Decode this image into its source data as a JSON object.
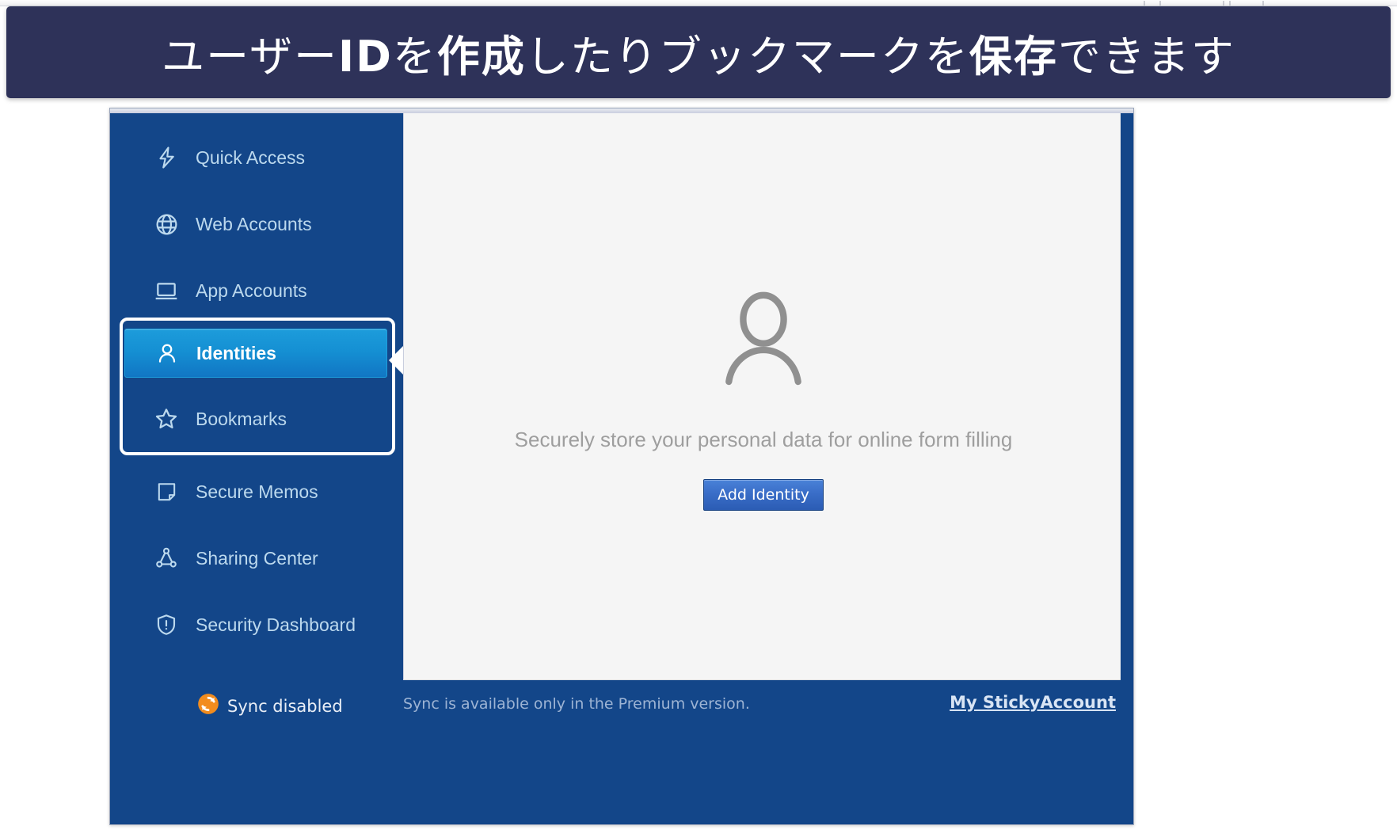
{
  "caption": {
    "text_lead": "ユーザー",
    "text_bold": "ID",
    "text_mid": "を",
    "text_bold2": "作成",
    "text_mid2": "したりブックマークを",
    "text_bold3": "保存",
    "text_tail": "できます",
    "full_text": "ユーザーIDを作成したりブックマークを保存できます",
    "background_color": "#2e3259",
    "text_color": "#ffffff"
  },
  "app": {
    "accent_color": "#134689",
    "selected_color": "#1590d3",
    "sidebar": {
      "items": [
        {
          "label": "Quick Access",
          "icon": "lightning-bolt-icon",
          "selected": false
        },
        {
          "label": "Web Accounts",
          "icon": "globe-icon",
          "selected": false
        },
        {
          "label": "App Accounts",
          "icon": "laptop-icon",
          "selected": false
        },
        {
          "label": "Identities",
          "icon": "person-icon",
          "selected": true
        },
        {
          "label": "Bookmarks",
          "icon": "star-icon",
          "selected": false
        },
        {
          "label": "Secure Memos",
          "icon": "note-icon",
          "selected": false
        },
        {
          "label": "Sharing Center",
          "icon": "share-nodes-icon",
          "selected": false
        },
        {
          "label": "Security Dashboard",
          "icon": "shield-alert-icon",
          "selected": false
        }
      ]
    },
    "content": {
      "placeholder_icon": "person-placeholder-icon",
      "message": "Securely store your personal data for online form filling",
      "add_button_label": "Add Identity"
    },
    "footer": {
      "sync_icon": "sync-refresh-icon",
      "sync_status": "Sync disabled",
      "premium_note": "Sync is available only in the Premium version.",
      "account_link": "My StickyAccount",
      "sync_icon_color": "#f28c1e"
    }
  }
}
